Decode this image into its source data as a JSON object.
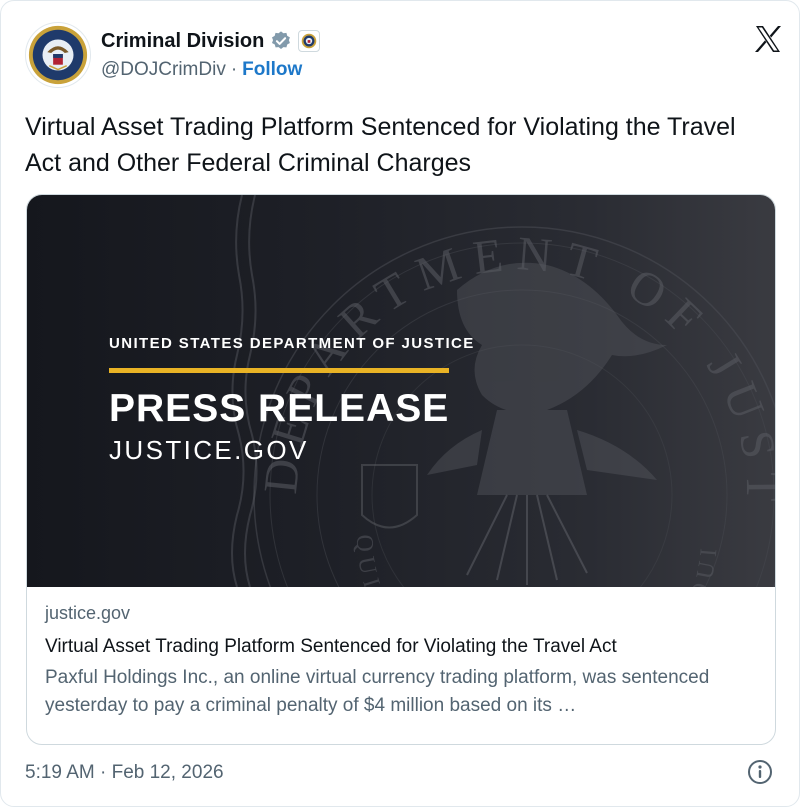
{
  "author": {
    "name": "Criminal Division",
    "handle": "@DOJCrimDiv",
    "separator": "·",
    "follow_label": "Follow"
  },
  "tweet": {
    "text": "Virtual Asset Trading Platform Sentenced for Violating the Travel Act and Other Federal Criminal Charges"
  },
  "card": {
    "image": {
      "kicker": "UNITED STATES DEPARTMENT OF JUSTICE",
      "title": "PRESS RELEASE",
      "url": "JUSTICE.GOV",
      "seal_top_text": "DEPARTMENT OF JUSTICE",
      "seal_bottom_text": "QUI PRO DOMINA JUSTITIA SEQUITUR"
    },
    "domain": "justice.gov",
    "title": "Virtual Asset Trading Platform Sentenced for Violating the Travel Act",
    "description": "Paxful Holdings Inc., an online virtual currency trading platform, was sentenced yesterday to pay a criminal penalty of $4 million based on its …"
  },
  "footer": {
    "timestamp": "5:19 AM · Feb 12, 2026"
  },
  "colors": {
    "follow_blue": "#1d78c9",
    "verified_gray": "#829aab",
    "press_bar_gold": "#e9b325",
    "card_bg_dark": "#1e2027",
    "seal_navy": "#1f3a6b",
    "seal_gold": "#c9a23a"
  },
  "icons": {
    "verified": "verified-badge-icon",
    "affiliate": "doj-seal-affiliate-icon",
    "platform": "x-logo-icon",
    "info": "info-icon"
  }
}
